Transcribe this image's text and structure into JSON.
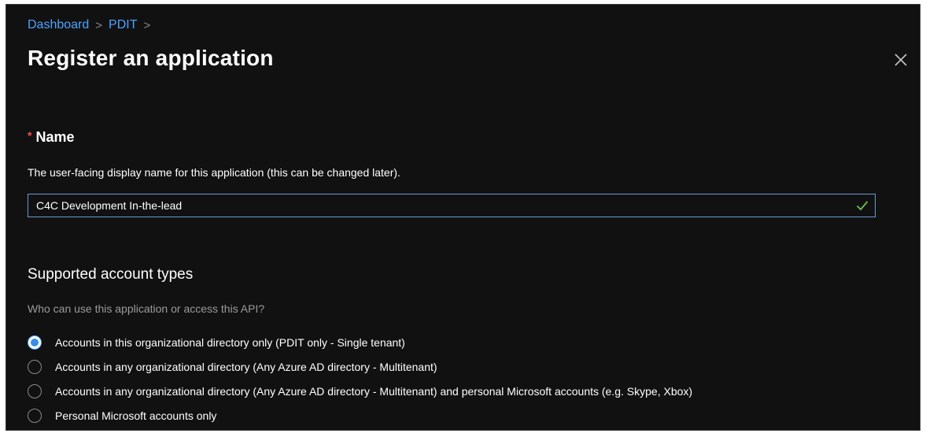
{
  "breadcrumb": {
    "items": [
      "Dashboard",
      "PDIT"
    ],
    "separator": ">"
  },
  "page": {
    "title": "Register an application",
    "close_icon": "close-icon"
  },
  "name_field": {
    "required_marker": "*",
    "label": "Name",
    "help": "The user-facing display name for this application (this can be changed later).",
    "value": "C4C Development In-the-lead",
    "valid_icon": "check-icon"
  },
  "account_types": {
    "title": "Supported account types",
    "help": "Who can use this application or access this API?",
    "options": [
      {
        "label": "Accounts in this organizational directory only (PDIT only - Single tenant)",
        "selected": true
      },
      {
        "label": "Accounts in any organizational directory (Any Azure AD directory - Multitenant)",
        "selected": false
      },
      {
        "label": "Accounts in any organizational directory (Any Azure AD directory - Multitenant) and personal Microsoft accounts (e.g. Skype, Xbox)",
        "selected": false
      },
      {
        "label": "Personal Microsoft accounts only",
        "selected": false
      }
    ]
  },
  "colors": {
    "background": "#111112",
    "link": "#4da3ff",
    "required": "#ff4d4d",
    "input_border": "#6b9ad6",
    "valid_check": "#6cc04a",
    "muted_text": "#9a9a9a"
  }
}
